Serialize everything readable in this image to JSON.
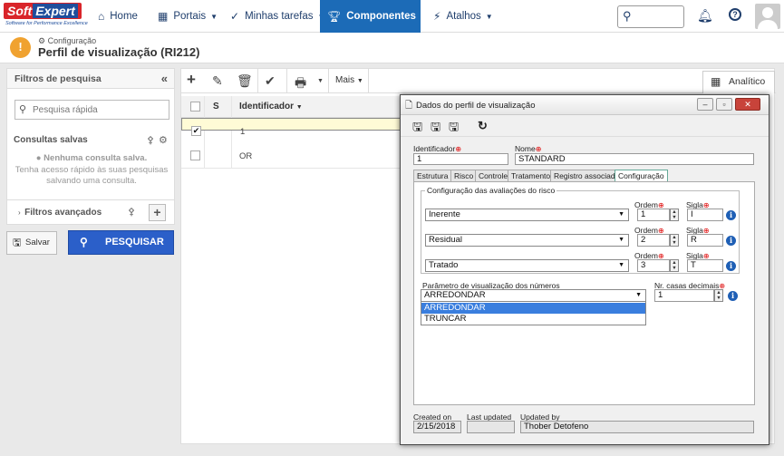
{
  "topbar": {
    "logo_soft": "Soft",
    "logo_expert": "Expert",
    "logo_tagline": "Software for Performance Excellence",
    "nav": [
      {
        "label": "Home",
        "icon": "home-icon"
      },
      {
        "label": "Portais",
        "icon": "grid-icon"
      },
      {
        "label": "Minhas tarefas",
        "icon": "check-icon"
      },
      {
        "label": "Componentes",
        "icon": "trophy-icon"
      },
      {
        "label": "Atalhos",
        "icon": "bolt-icon"
      }
    ]
  },
  "page": {
    "breadcrumb": "Configuração",
    "title": "Perfil de visualização (RI212)"
  },
  "left": {
    "header": "Filtros de pesquisa",
    "search_placeholder": "Pesquisa rápida",
    "saved_title": "Consultas salvas",
    "none_title": "Nenhuma consulta salva.",
    "none_line1": "Tenha acesso rápido às suas pesquisas",
    "none_line2": "salvando uma consulta.",
    "advanced": "Filtros avançados",
    "save_btn": "Salvar",
    "search_btn": "PESQUISAR"
  },
  "main": {
    "mais": "Mais",
    "analitico": "Analítico",
    "col_s": "S",
    "col_id": "Identificador",
    "rows": [
      {
        "id": "1",
        "checked": true
      },
      {
        "id": "OR",
        "checked": false
      }
    ]
  },
  "dialog": {
    "title": "Dados do perfil de visualização",
    "id_label": "Identificador",
    "id_value": "1",
    "name_label": "Nome",
    "name_value": "STANDARD",
    "tabs": [
      "Estrutura",
      "Risco",
      "Controle",
      "Tratamento",
      "Registro associado",
      "Configuração"
    ],
    "active_tab": "Configuração",
    "group_title": "Configuração das avaliações do risco",
    "ordem_label": "Ordem",
    "sigla_label": "Sigla",
    "risk_rows": [
      {
        "type": "Inerente",
        "ordem": "1",
        "sigla": "I"
      },
      {
        "type": "Residual",
        "ordem": "2",
        "sigla": "R"
      },
      {
        "type": "Tratado",
        "ordem": "3",
        "sigla": "T"
      }
    ],
    "num_param_label": "Parâmetro de visualização dos números",
    "num_param_value": "ARREDONDAR",
    "num_options": [
      "ARREDONDAR",
      "TRUNCAR"
    ],
    "decimals_label": "Nr. casas decimais",
    "decimals_value": "1",
    "created_label": "Created on",
    "created_value": "2/15/2018",
    "updated_label": "Last updated",
    "updated_value": "",
    "updated_by_label": "Updated by",
    "updated_by_value": "Thober Detofeno"
  },
  "colors": {
    "nav_active": "#1c6bb7",
    "search_btn": "#2b5fc9",
    "warn": "#f0a230",
    "row_selected": "#fffbd6"
  }
}
